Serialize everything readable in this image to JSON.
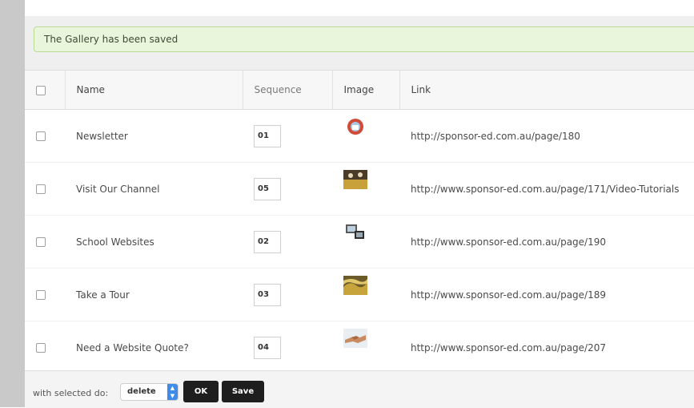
{
  "notice": {
    "message": "The Gallery has been saved"
  },
  "table": {
    "headers": {
      "name": "Name",
      "sequence": "Sequence",
      "image": "Image",
      "link": "Link"
    },
    "rows": [
      {
        "name": "Newsletter",
        "sequence": "01",
        "image_icon": "newsletter-thumbnail-icon",
        "link": "http://sponsor-ed.com.au/page/180"
      },
      {
        "name": "Visit Our Channel",
        "sequence": "05",
        "image_icon": "channel-thumbnail-icon",
        "link": "http://www.sponsor-ed.com.au/page/171/Video-Tutorials"
      },
      {
        "name": "School Websites",
        "sequence": "02",
        "image_icon": "school-websites-thumbnail-icon",
        "link": "http://www.sponsor-ed.com.au/page/190"
      },
      {
        "name": "Take a Tour",
        "sequence": "03",
        "image_icon": "tour-thumbnail-icon",
        "link": "http://www.sponsor-ed.com.au/page/189"
      },
      {
        "name": "Need a Website Quote?",
        "sequence": "04",
        "image_icon": "handshake-thumbnail-icon",
        "link": "http://www.sponsor-ed.com.au/page/207"
      }
    ]
  },
  "footer": {
    "label": "with selected do:",
    "action_value": "delete",
    "ok_label": "OK",
    "save_label": "Save"
  },
  "colors": {
    "notice_bg": "#eaf6dc",
    "notice_border": "#b9db93",
    "select_accent": "#3e8be8",
    "button_bg": "#1e1e1e"
  }
}
